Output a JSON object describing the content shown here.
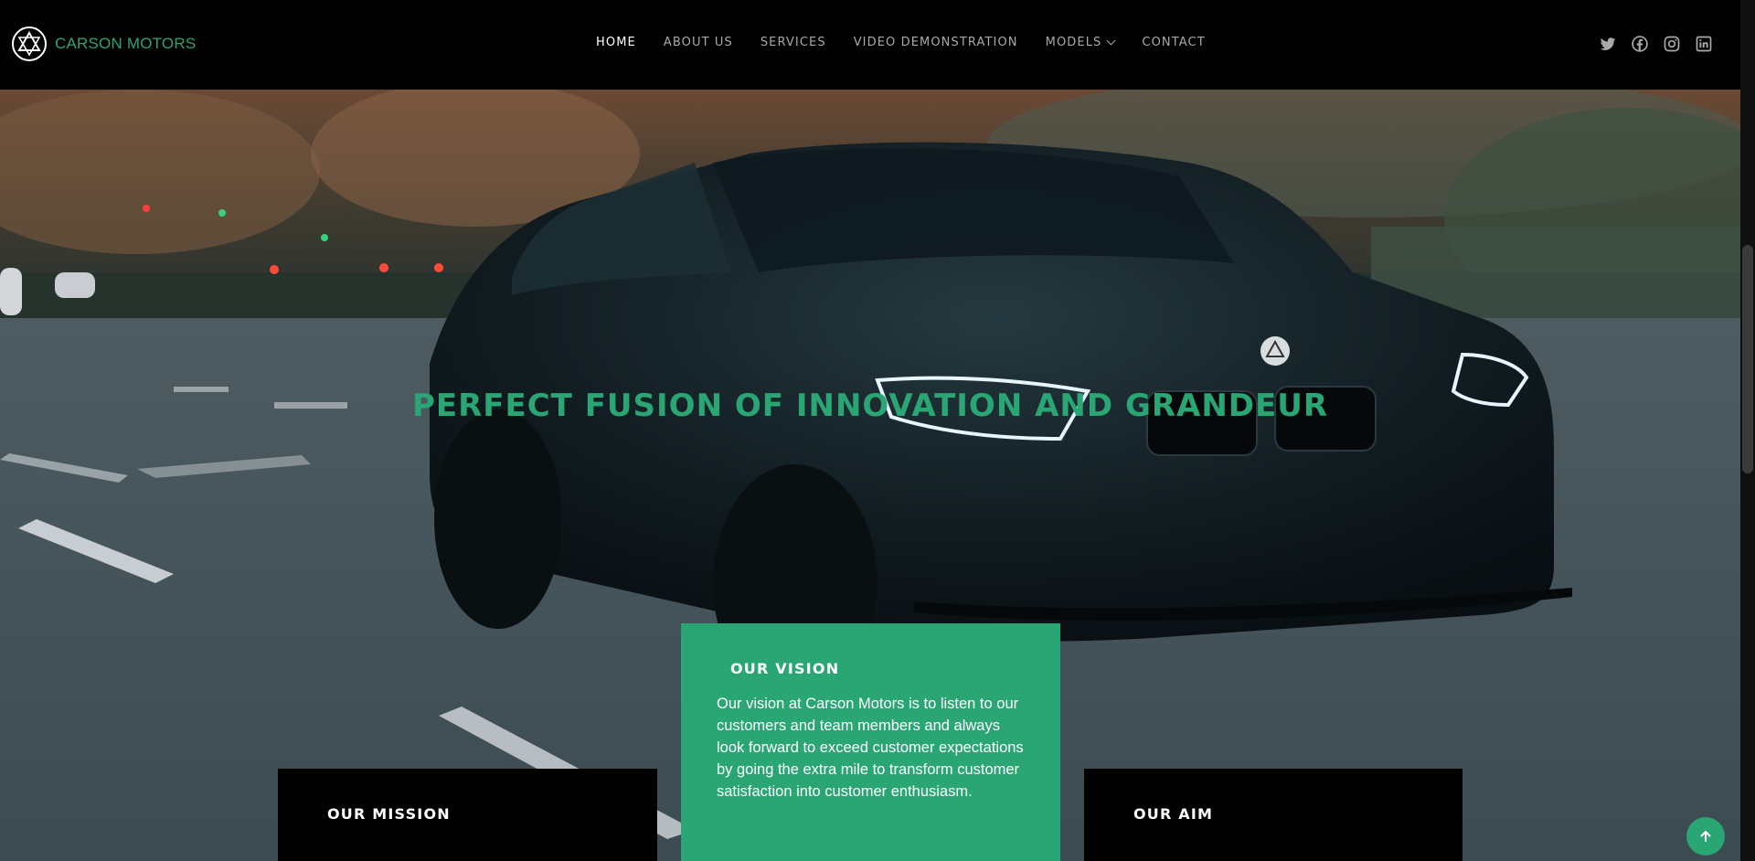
{
  "brand": {
    "name": "CARSON MOTORS",
    "accent": "#2aa574"
  },
  "nav": {
    "items": [
      {
        "label": "HOME",
        "active": true
      },
      {
        "label": "ABOUT US"
      },
      {
        "label": "SERVICES"
      },
      {
        "label": "VIDEO DEMONSTRATION"
      },
      {
        "label": "MODELS",
        "dropdown": true
      },
      {
        "label": "CONTACT"
      }
    ]
  },
  "social": [
    "twitter-icon",
    "facebook-icon",
    "instagram-icon",
    "linkedin-icon"
  ],
  "hero": {
    "title": "PERFECT FUSION OF INNOVATION AND GRANDEUR"
  },
  "cards": {
    "mission": {
      "title": "OUR MISSION"
    },
    "vision": {
      "title": "OUR VISION",
      "text": "Our vision at Carson Motors is to listen to our customers and team members and always look forward to exceed customer expectations by going the extra mile to transform customer satisfaction into customer enthusiasm."
    },
    "aim": {
      "title": "OUR AIM"
    }
  },
  "scroll_to_top": "arrow-up-icon"
}
